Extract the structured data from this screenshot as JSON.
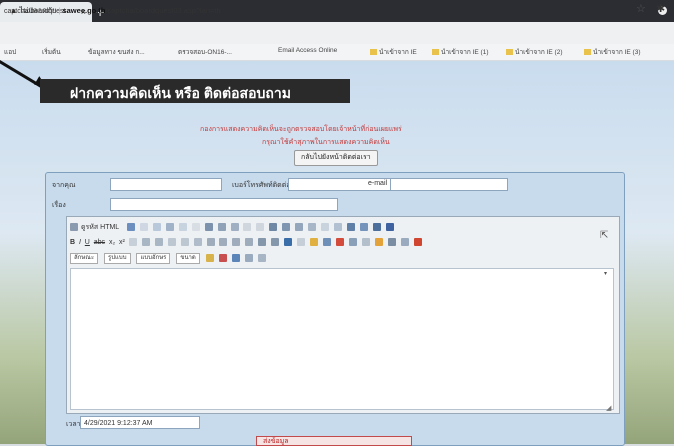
{
  "browser": {
    "tab_title": "captcha/boardquest",
    "tab_close": "×",
    "new_tab": "+",
    "address": {
      "host": "sawee.go.th",
      "path": "/captcha/boardquest03.asp?lan=th",
      "prefix": "ไม่ปลอดภัย"
    },
    "bookmarks": [
      "แอป",
      "เริ่มต้น",
      "ข้อมูลทาง ขนส่ง ก...",
      "ตรวจสอบ-ON16-...",
      "Email Access Online",
      "นำเข้าจาก IE",
      "นำเข้าจาก IE (1)",
      "นำเข้าจาก IE (2)",
      "นำเข้าจาก IE (3)"
    ]
  },
  "page": {
    "title": "ฝากความคิดเห็น หรือ ติดต่อสอบถาม",
    "notice_line1": "กองการแสดงความคิดเห็นจะถูกตรวจสอบโดยเจ้าหน้าที่ก่อนเผยแพร่",
    "notice_line2": "กรุณาใช้คำสุภาพในการแสดงความคิดเห็น",
    "back_button": "กลับไปยังหน้าติดต่อเรา"
  },
  "form": {
    "from_label": "จากคุณ",
    "phone_label": "เบอร์โทรศัพท์ติดต่อกลับ",
    "email_label": "e-mail",
    "subject_label": "เรื่อง",
    "date_label": "เวลา",
    "date_value": "4/29/2021 9:12:37 AM",
    "submit_label": "ส่งข้อมูล"
  },
  "editor": {
    "toolbar1_source": "ดูรหัส HTML",
    "format_select": "ลักษณะ",
    "style_select": "รูปแบบ",
    "font_select": "แบบอักษร",
    "size_select": "ขนาด"
  }
}
